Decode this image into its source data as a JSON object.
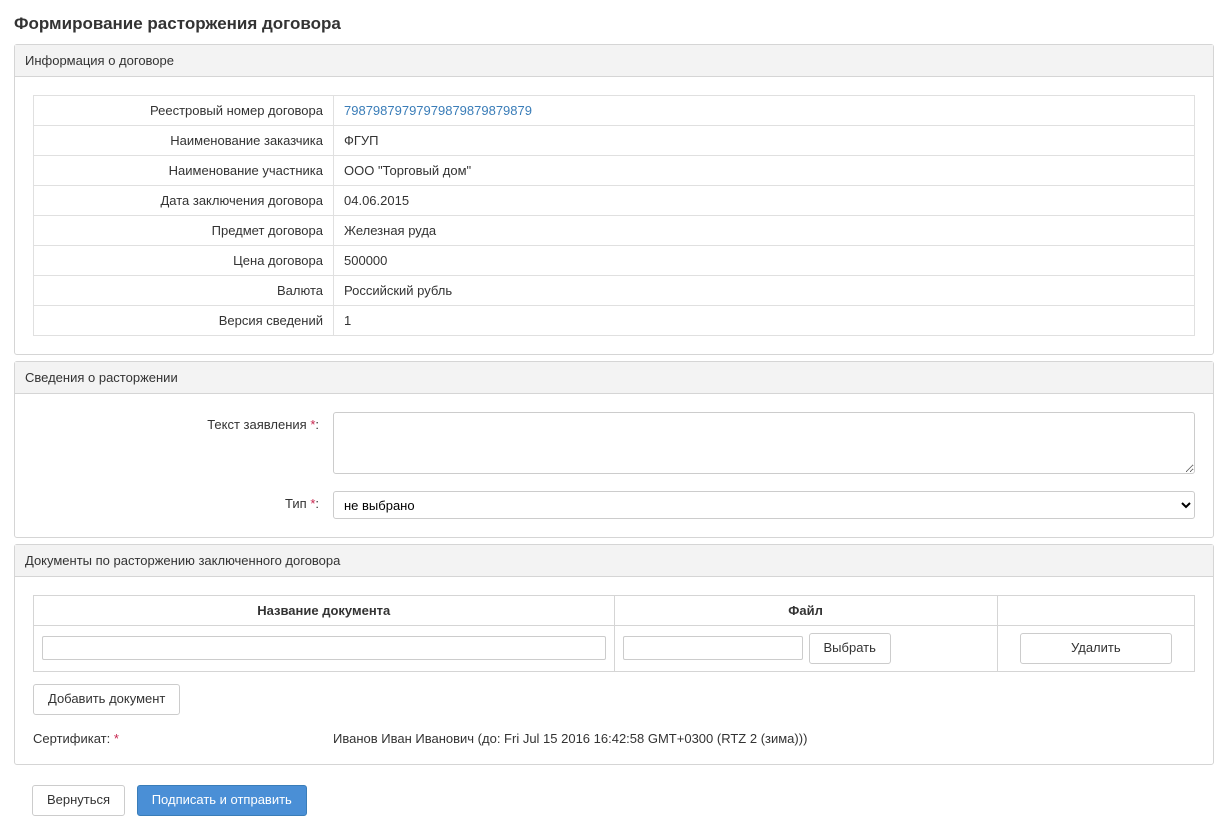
{
  "page_title": "Формирование расторжения договора",
  "sections": {
    "info": {
      "title": "Информация о договоре",
      "rows": {
        "registry_number": {
          "label": "Реестровый номер договора",
          "value": "798798797979798798798798​79",
          "is_link": true
        },
        "customer_name": {
          "label": "Наименование заказчика",
          "value": "ФГУП"
        },
        "participant_name": {
          "label": "Наименование участника",
          "value": "ООО \"Торговый дом\""
        },
        "conclusion_date": {
          "label": "Дата заключения договора",
          "value": "04.06.2015"
        },
        "subject": {
          "label": "Предмет договора",
          "value": "Железная руда"
        },
        "price": {
          "label": "Цена договора",
          "value": "500000"
        },
        "currency": {
          "label": "Валюта",
          "value": "Российский рубль"
        },
        "version": {
          "label": "Версия сведений",
          "value": "1"
        }
      }
    },
    "termination": {
      "title": "Сведения о расторжении",
      "statement_label": "Текст заявления",
      "type_label": "Тип",
      "type_placeholder": "не выбрано"
    },
    "documents": {
      "title": "Документы по расторжению заключенного договора",
      "col_name": "Название документа",
      "col_file": "Файл",
      "choose_btn": "Выбрать",
      "delete_btn": "Удалить",
      "add_btn": "Добавить документ"
    }
  },
  "certificate": {
    "label": "Сертификат:",
    "value": "Иванов Иван Иванович (до: Fri Jul 15 2016 16:42:58 GMT+0300 (RTZ 2 (зима)))"
  },
  "footer": {
    "back": "Вернуться",
    "submit": "Подписать и отправить"
  }
}
